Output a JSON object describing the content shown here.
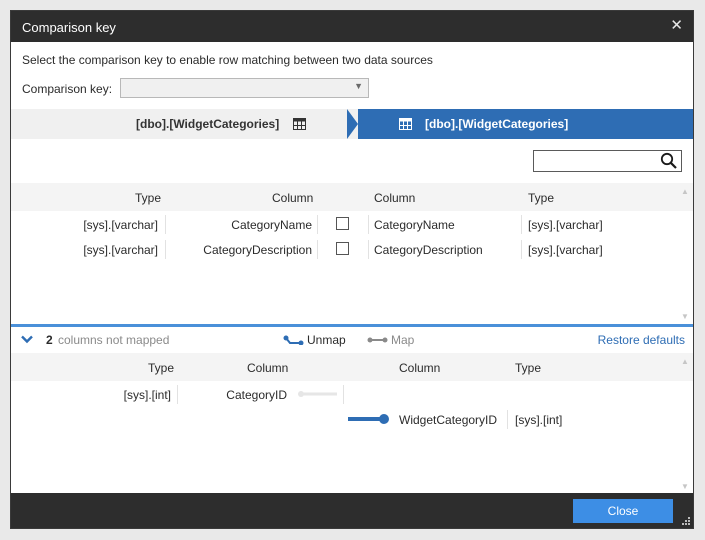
{
  "window": {
    "title": "Comparison key"
  },
  "instruction": "Select the comparison key to enable row matching between two data sources",
  "comparison_key": {
    "label": "Comparison key:",
    "value": ""
  },
  "tabs": {
    "left": "[dbo].[WidgetCategories]",
    "right": "[dbo].[WidgetCategories]"
  },
  "search": {
    "value": ""
  },
  "mapped_grid": {
    "headers": {
      "type_left": "Type",
      "column_left": "Column",
      "column_right": "Column",
      "type_right": "Type"
    },
    "rows": [
      {
        "type_left": "[sys].[varchar]",
        "column_left": "CategoryName",
        "checked": false,
        "column_right": "CategoryName",
        "type_right": "[sys].[varchar]"
      },
      {
        "type_left": "[sys].[varchar]",
        "column_left": "CategoryDescription",
        "checked": false,
        "column_right": "CategoryDescription",
        "type_right": "[sys].[varchar]"
      }
    ]
  },
  "unmapped": {
    "count": "2",
    "text": "columns not mapped",
    "unmap_label": "Unmap",
    "map_label": "Map",
    "restore_label": "Restore defaults"
  },
  "unmapped_grid": {
    "headers": {
      "type_left": "Type",
      "column_left": "Column",
      "column_right": "Column",
      "type_right": "Type"
    },
    "rows": [
      {
        "type_left": "[sys].[int]",
        "column_left": "CategoryID"
      },
      {
        "column_right": "WidgetCategoryID",
        "type_right": "[sys].[int]"
      }
    ]
  },
  "footer": {
    "close_label": "Close"
  },
  "colors": {
    "accent": "#2e6db4",
    "button": "#3d8ee5",
    "titlebar": "#2d2d2d"
  }
}
